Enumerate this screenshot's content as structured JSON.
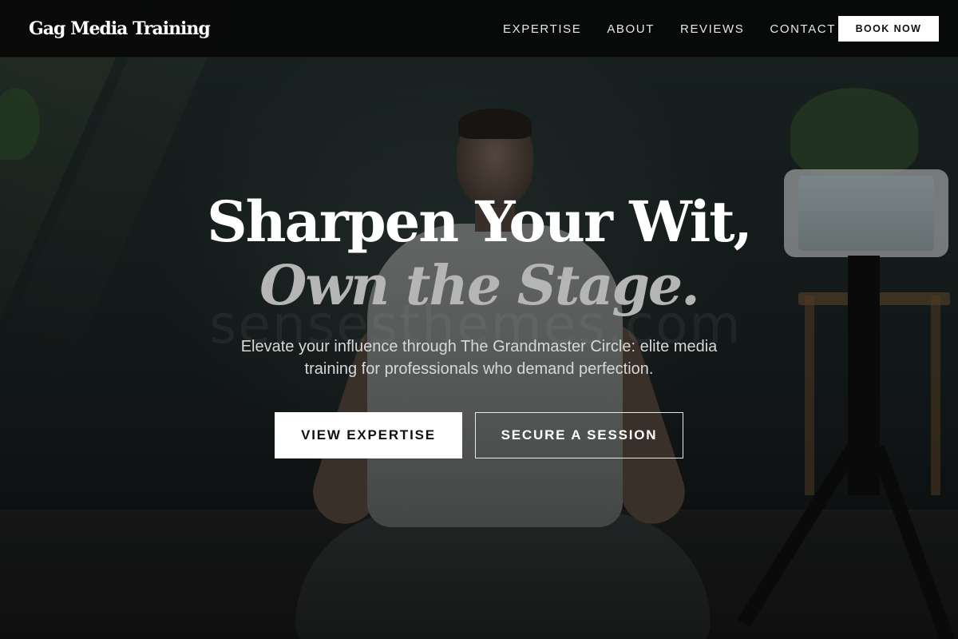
{
  "navbar": {
    "logo": "Gag Media Training",
    "links": [
      {
        "label": "EXPERTISE"
      },
      {
        "label": "ABOUT"
      },
      {
        "label": "REVIEWS"
      },
      {
        "label": "CONTACT"
      }
    ],
    "book_button": "BOOK NOW"
  },
  "hero": {
    "headline_line1": "Sharpen Your Wit,",
    "headline_line2": "Own the Stage.",
    "subtext": "Elevate your influence through The Grandmaster Circle: elite media training for professionals who demand perfection.",
    "primary_cta": "VIEW EXPERTISE",
    "secondary_cta": "SECURE A SESSION",
    "background_watermark": "sensesthemes.com"
  },
  "colors": {
    "nav_background": "#080808",
    "headline_primary": "#ffffff",
    "headline_accent": "#b5b5b5",
    "button_primary_bg": "#ffffff"
  }
}
